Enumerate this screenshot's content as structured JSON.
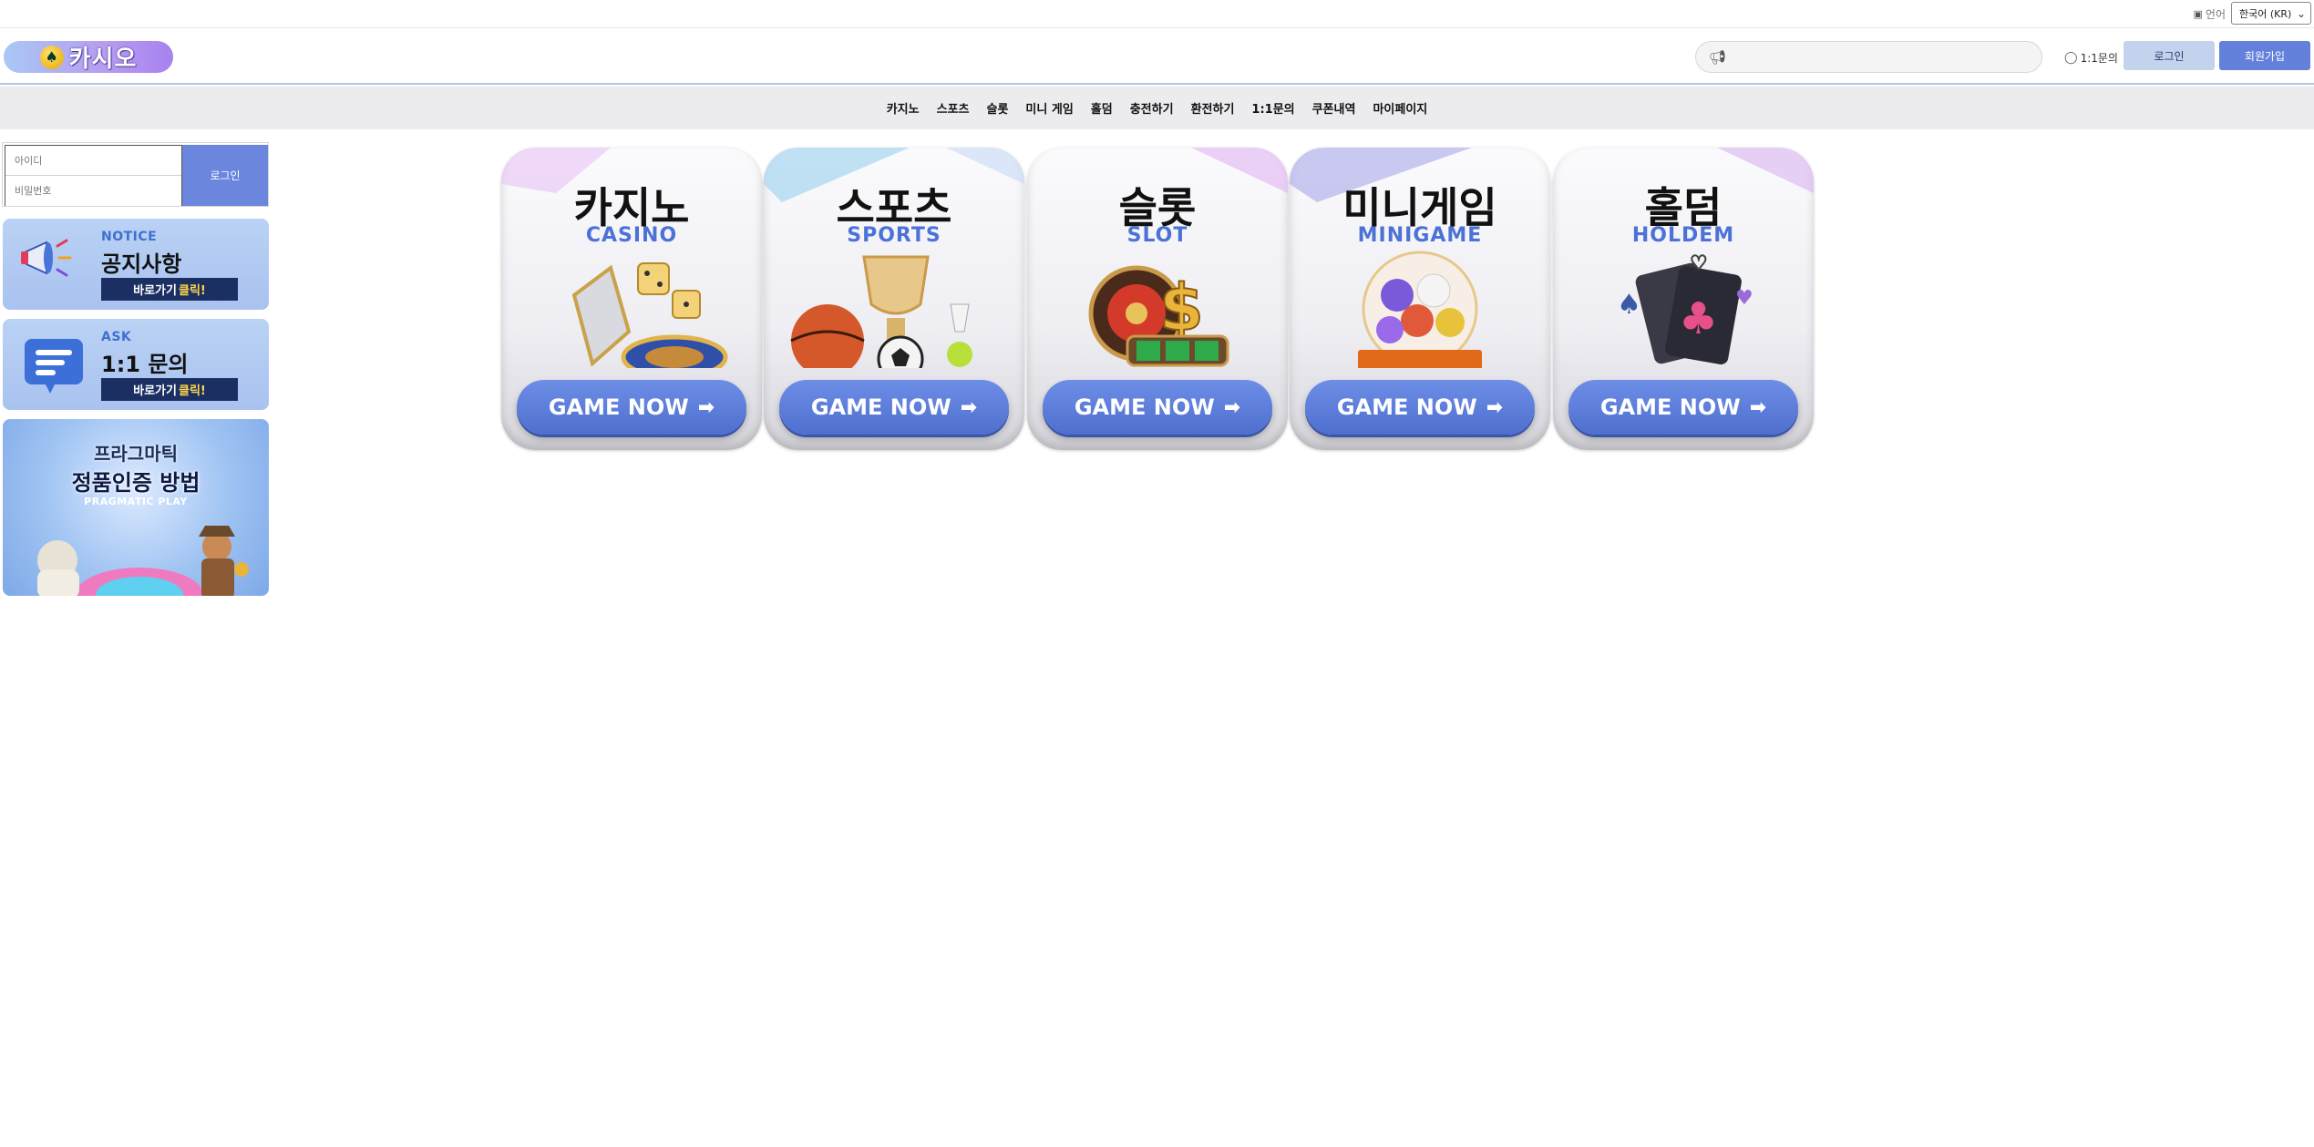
{
  "topbar": {
    "lang_label": "언어",
    "lang_value": "한국어 (KR)"
  },
  "header": {
    "logo_text": "카시오",
    "inquiry_label": "1:1문의",
    "login_label": "로그인",
    "join_label": "회원가입"
  },
  "nav": {
    "items": [
      "카지노",
      "스포츠",
      "슬롯",
      "미니 게임",
      "홀덤",
      "충전하기",
      "환전하기",
      "1:1문의",
      "쿠폰내역",
      "마이페이지"
    ]
  },
  "sidebar": {
    "id_placeholder": "아이디",
    "pw_placeholder": "비밀번호",
    "login_button": "로그인",
    "notice": {
      "tag": "NOTICE",
      "title": "공지사항",
      "cta": "바로가기",
      "cta_highlight": "클릭!"
    },
    "ask": {
      "tag": "ASK",
      "title": "1:1 문의",
      "cta": "바로가기",
      "cta_highlight": "클릭!"
    },
    "pragmatic": {
      "title_top": "프라그마틱",
      "title_main": "정품인증 방법",
      "brand": "PRAGMATIC PLAY"
    }
  },
  "games": [
    {
      "kr": "카지노",
      "en": "CASINO",
      "button": "GAME NOW"
    },
    {
      "kr": "스포츠",
      "en": "SPORTS",
      "button": "GAME NOW"
    },
    {
      "kr": "슬롯",
      "en": "SLOT",
      "button": "GAME NOW"
    },
    {
      "kr": "미니게임",
      "en": "MINIGAME",
      "button": "GAME NOW"
    },
    {
      "kr": "홀덤",
      "en": "HOLDEM",
      "button": "GAME NOW"
    }
  ],
  "colors": {
    "accent": "#6380db",
    "nav_bg": "#ececee",
    "login_btn_bg": "#c4d2ee",
    "title_blue": "#4c72d8"
  }
}
